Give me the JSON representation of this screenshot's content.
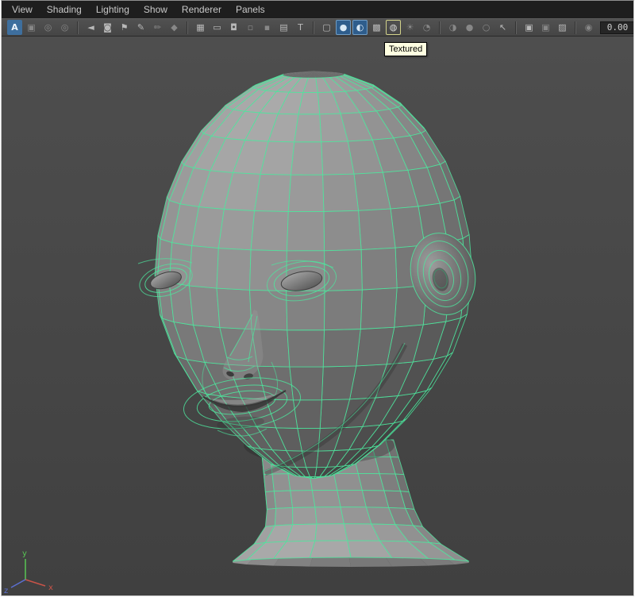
{
  "menubar": {
    "items": [
      "View",
      "Shading",
      "Lighting",
      "Show",
      "Renderer",
      "Panels"
    ]
  },
  "toolbar": {
    "field_value": "0.00",
    "groups": [
      {
        "name": "camera-tools",
        "items": [
          {
            "name": "select-camera",
            "glyph": "A",
            "variant": "accent"
          },
          {
            "name": "lock-camera",
            "glyph": "▣",
            "variant": "dim"
          },
          {
            "name": "camera-attributes",
            "glyph": "◎",
            "variant": "dim"
          },
          {
            "name": "bookmark-view",
            "glyph": "◎",
            "variant": "dim"
          }
        ]
      },
      {
        "name": "view-extras",
        "items": [
          {
            "name": "image-plane",
            "glyph": "◄",
            "variant": "normal"
          },
          {
            "name": "shot-camera",
            "glyph": "◙",
            "variant": "normal"
          },
          {
            "name": "view-bookmark-flag",
            "glyph": "⚑",
            "variant": "normal"
          },
          {
            "name": "grease-pencil",
            "glyph": "✎",
            "variant": "normal"
          },
          {
            "name": "grease-pencil-frames",
            "glyph": "✏",
            "variant": "dim"
          },
          {
            "name": "two-d-pan-zoom",
            "glyph": "◆",
            "variant": "dim"
          }
        ]
      },
      {
        "name": "gates-and-guides",
        "items": [
          {
            "name": "grid-toggle",
            "glyph": "▦",
            "variant": "normal"
          },
          {
            "name": "film-gate",
            "glyph": "▭",
            "variant": "normal"
          },
          {
            "name": "resolution-gate",
            "glyph": "◘",
            "variant": "normal"
          },
          {
            "name": "gate-mask",
            "glyph": "▫",
            "variant": "dim"
          },
          {
            "name": "field-chart",
            "glyph": "▪",
            "variant": "dim"
          },
          {
            "name": "safe-action",
            "glyph": "▤",
            "variant": "normal"
          },
          {
            "name": "safe-title",
            "glyph": "T",
            "variant": "normal"
          }
        ]
      },
      {
        "name": "display-modes",
        "items": [
          {
            "name": "wireframe-display",
            "glyph": "▢",
            "variant": "normal"
          },
          {
            "name": "smooth-shade-display",
            "glyph": "●",
            "variant": "active"
          },
          {
            "name": "smooth-shade-wire-display",
            "glyph": "◐",
            "variant": "active"
          },
          {
            "name": "flat-shade-display",
            "glyph": "▩",
            "variant": "normal"
          },
          {
            "name": "textured-display",
            "glyph": "◍",
            "variant": "hover"
          },
          {
            "name": "use-default-material",
            "glyph": "☀",
            "variant": "dim"
          },
          {
            "name": "xray-display",
            "glyph": "◔",
            "variant": "dim"
          }
        ]
      },
      {
        "name": "lighting",
        "items": [
          {
            "name": "all-lights",
            "glyph": "◑",
            "variant": "dim"
          },
          {
            "name": "default-lighting",
            "glyph": "●",
            "variant": "dim"
          },
          {
            "name": "shadows-toggle",
            "glyph": "○",
            "variant": "dim"
          }
        ]
      }
    ],
    "right_groups": [
      {
        "name": "selection",
        "items": [
          {
            "name": "select-tool",
            "glyph": "↖",
            "variant": "normal"
          }
        ]
      },
      {
        "name": "isolate",
        "items": [
          {
            "name": "isolate-select",
            "glyph": "▣",
            "variant": "normal"
          },
          {
            "name": "isolate-add-selected",
            "glyph": "▣",
            "variant": "dim"
          },
          {
            "name": "image-plane-display",
            "glyph": "▨",
            "variant": "normal"
          }
        ]
      },
      {
        "name": "settings",
        "items": [
          {
            "name": "renderer-settings",
            "glyph": "◉",
            "variant": "dim"
          }
        ]
      }
    ]
  },
  "tooltip": {
    "text": "Textured",
    "bg": "#ffffe1"
  },
  "viewport": {
    "wireframe_color": "#4de69e",
    "bg_top": "#4e4e4e",
    "bg_bottom": "#404040",
    "axis": {
      "y": {
        "label": "y",
        "color": "#58c554"
      },
      "x": {
        "label": "x",
        "color": "#c85348"
      },
      "z": {
        "label": "z",
        "color": "#5b6fd2"
      }
    }
  }
}
